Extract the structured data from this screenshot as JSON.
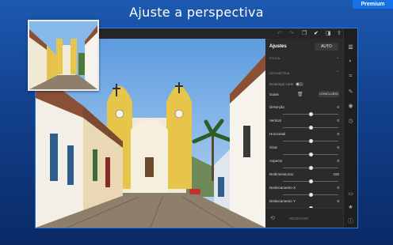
{
  "headline": "Ajuste a perspectiva",
  "premium_badge": "Premium",
  "panel": {
    "title": "Ajustes",
    "auto_label": "AUTO",
    "optics_section": "ÓTICA",
    "geometry_section": "GEOMETRIA",
    "constrain_crop_label": "Restringir corte",
    "guides_label": "Guias",
    "done_label": "CONCLUÍDO",
    "sliders": [
      {
        "label": "Distorção",
        "value": "0",
        "level": 0.5
      },
      {
        "label": "Vertical",
        "value": "0",
        "level": 0.5
      },
      {
        "label": "Horizontal",
        "value": "0",
        "level": 0.5
      },
      {
        "label": "Girar",
        "value": "0",
        "level": 0.5
      },
      {
        "label": "Aspecto",
        "value": "0",
        "level": 0.5
      },
      {
        "label": "Redimensionar",
        "value": "100",
        "level": 0.5
      },
      {
        "label": "Deslocamento X",
        "value": "0",
        "level": 0.5
      },
      {
        "label": "Deslocamento Y",
        "value": "0",
        "level": 0.5
      }
    ],
    "reset_label": "REDEFINIR"
  },
  "icons": {
    "toolbar": [
      "undo-icon",
      "redo-icon",
      "copy-icon",
      "check-icon",
      "compare-icon",
      "share-icon",
      "more-icon"
    ],
    "rail": [
      "sliders-icon",
      "presets-icon",
      "crop-icon",
      "brush-icon",
      "selective-icon",
      "history-icon",
      "comment-icon",
      "star-icon",
      "info-icon"
    ]
  },
  "colors": {
    "accent": "#1472e6",
    "background": "#12408c",
    "panel": "#2b2b2b"
  }
}
